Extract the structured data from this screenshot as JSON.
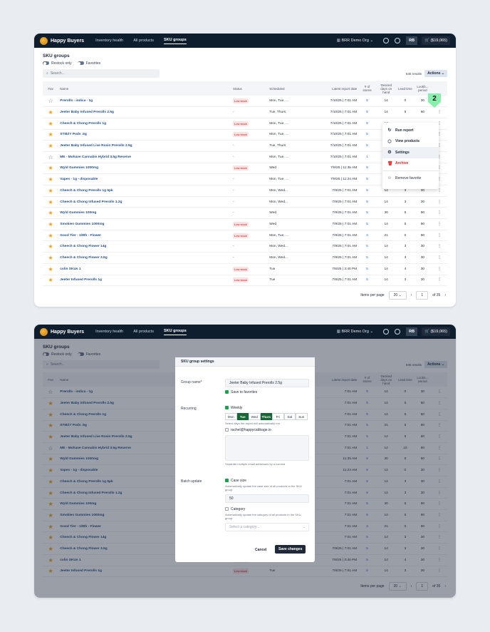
{
  "nav": {
    "brand": "Happy Buyers",
    "items": [
      "Inventory health",
      "All products",
      "SKU groups"
    ],
    "active": "SKU groups",
    "org": "BRR Demo Org",
    "user": "RB",
    "cart": "($19,065)"
  },
  "page": {
    "title": "SKU groups",
    "toggle_restock": "Restock only",
    "toggle_favorites": "Favorites",
    "search_placeholder": "Search...",
    "results": "645 results",
    "actions": "Actions"
  },
  "columns": [
    "Fav",
    "Name",
    "Status",
    "Scheduled",
    "Latest report date",
    "# of stores",
    "Desired days on hand",
    "Lead time",
    "Lookb... period"
  ],
  "rows1": [
    {
      "fav": false,
      "name": "Prerolls - indica - 1g",
      "status": "Low stock",
      "sched": "Mon, Tue, ...",
      "date": "7/10/25 | 7:01 AM",
      "stores": "5",
      "ddoh": "14",
      "lead": "0",
      "look": "30"
    },
    {
      "fav": true,
      "name": "Jeeter Baby Infused Prerolls 2.5g",
      "status": "-",
      "sched": "Tue, Thurs",
      "date": "7/10/25 | 7:01 AM",
      "stores": "5",
      "ddoh": "14",
      "lead": "5",
      "look": "60"
    },
    {
      "fav": true,
      "name": "Cheech & Chong Prerolls 1g",
      "status": "Low stock",
      "sched": "Mon, Tue, ...",
      "date": "7/10/25 | 7:01 AM",
      "stores": "5",
      "ddoh": "14",
      "lead": "",
      "look": ""
    },
    {
      "fav": true,
      "name": "STIIIZY Pods .5g",
      "status": "Low stock",
      "sched": "Mon, Tue, ...",
      "date": "7/10/25 | 7:01 AM",
      "stores": "5",
      "ddoh": "21",
      "lead": "",
      "look": ""
    },
    {
      "fav": true,
      "name": "Jeeter Baby Infused Live Rosin Prerolls 2.5g",
      "status": "-",
      "sched": "Tue, Thurs",
      "date": "7/10/25 | 7:01 AM",
      "stores": "5",
      "ddoh": "14",
      "lead": "",
      "look": ""
    },
    {
      "fav": false,
      "name": "ME - Mohave Cannabis Hybrid 3.5g Reserve",
      "status": "-",
      "sched": "Mon, Tue, ...",
      "date": "7/10/25 | 7:01 AM",
      "stores": "1",
      "ddoh": "14",
      "lead": "",
      "look": ""
    },
    {
      "fav": true,
      "name": "Wyld Gummies 1000mg",
      "status": "Low stock",
      "sched": "Wed",
      "date": "7/9/25 | 11:35 AM",
      "stores": "5",
      "ddoh": "30",
      "lead": "",
      "look": ""
    },
    {
      "fav": true,
      "name": "Vapes - 1g - disposable",
      "status": "-",
      "sched": "Mon, Tue, ...",
      "date": "7/9/25 | 11:24 AM",
      "stores": "5",
      "ddoh": "14",
      "lead": "",
      "look": ""
    },
    {
      "fav": true,
      "name": "Cheech & Chong Prerolls 1g 5pk",
      "status": "-",
      "sched": "Mon, Wed...",
      "date": "7/9/25 | 7:01 AM",
      "stores": "5",
      "ddoh": "14",
      "lead": "3",
      "look": "30"
    },
    {
      "fav": true,
      "name": "Cheech & Chong Infused Prerolls 1.2g",
      "status": "-",
      "sched": "Mon, Wed...",
      "date": "7/9/25 | 7:01 AM",
      "stores": "5",
      "ddoh": "14",
      "lead": "3",
      "look": "30"
    },
    {
      "fav": true,
      "name": "Wyld Gummies 100mg",
      "status": "-",
      "sched": "Wed",
      "date": "7/9/25 | 7:01 AM",
      "stores": "5",
      "ddoh": "30",
      "lead": "5",
      "look": "90"
    },
    {
      "fav": true,
      "name": "Smokies Gummies 1000mg",
      "status": "Low stock",
      "sched": "Wed",
      "date": "7/9/25 | 7:01 AM",
      "stores": "5",
      "ddoh": "14",
      "lead": "5",
      "look": "90"
    },
    {
      "fav": true,
      "name": "Good Tier - 1/8th - Flower",
      "status": "Low stock",
      "sched": "Mon, Tue, ...",
      "date": "7/9/25 | 7:01 AM",
      "stores": "3",
      "ddoh": "21",
      "lead": "0",
      "look": "90"
    },
    {
      "fav": true,
      "name": "Cheech & Chong Flower 14g",
      "status": "-",
      "sched": "Mon, Wed...",
      "date": "7/9/25 | 7:01 AM",
      "stores": "5",
      "ddoh": "14",
      "lead": "3",
      "look": "30"
    },
    {
      "fav": true,
      "name": "Cheech & Chong Flower 3.5g",
      "status": "-",
      "sched": "Mon, Wed...",
      "date": "7/9/25 | 7:01 AM",
      "stores": "5",
      "ddoh": "14",
      "lead": "3",
      "look": "30"
    },
    {
      "fav": true,
      "name": "colin SKUs 1",
      "status": "Low stock",
      "sched": "Tue",
      "date": "7/8/25 | 3:40 PM",
      "stores": "5",
      "ddoh": "14",
      "lead": "4",
      "look": "30"
    },
    {
      "fav": true,
      "name": "Jeeter Infused Prerolls 1g",
      "status": "Low stock",
      "sched": "Tue",
      "date": "7/8/25 | 7:01 AM",
      "stores": "5",
      "ddoh": "14",
      "lead": "3",
      "look": "30"
    }
  ],
  "rows2": [
    {
      "fav": false,
      "name": "Prerolls - indica - 1g",
      "status": "",
      "date": "7:01 AM",
      "stores": "5",
      "ddoh": "14",
      "lead": "0",
      "look": "30"
    },
    {
      "fav": true,
      "name": "Jeeter Baby Infused Prerolls 2.5g",
      "status": "",
      "date": "7:01 AM",
      "stores": "5",
      "ddoh": "14",
      "lead": "5",
      "look": "60"
    },
    {
      "fav": true,
      "name": "Cheech & Chong Prerolls 1g",
      "status": "",
      "date": "7:01 AM",
      "stores": "5",
      "ddoh": "14",
      "lead": "5",
      "look": "60"
    },
    {
      "fav": true,
      "name": "STIIIZY Pods .5g",
      "status": "",
      "date": "7:01 AM",
      "stores": "5",
      "ddoh": "21",
      "lead": "5",
      "look": "90"
    },
    {
      "fav": true,
      "name": "Jeeter Baby Infused Live Rosin Prerolls 2.5g",
      "status": "",
      "date": "7:01 AM",
      "stores": "5",
      "ddoh": "14",
      "lead": "5",
      "look": "60"
    },
    {
      "fav": false,
      "name": "ME - Mohave Cannabis Hybrid 3.5g Reserve",
      "status": "",
      "date": "7:01 AM",
      "stores": "1",
      "ddoh": "14",
      "lead": "10",
      "look": "90"
    },
    {
      "fav": true,
      "name": "Wyld Gummies 1000mg",
      "status": "",
      "date": "11:35 AM",
      "stores": "5",
      "ddoh": "30",
      "lead": "5",
      "look": "90"
    },
    {
      "fav": true,
      "name": "Vapes - 1g - disposable",
      "status": "",
      "date": "11:24 AM",
      "stores": "5",
      "ddoh": "14",
      "lead": "0",
      "look": "30"
    },
    {
      "fav": true,
      "name": "Cheech & Chong Prerolls 1g 5pk",
      "status": "",
      "date": "7:01 AM",
      "stores": "5",
      "ddoh": "14",
      "lead": "3",
      "look": "30"
    },
    {
      "fav": true,
      "name": "Cheech & Chong Infused Prerolls 1.2g",
      "status": "",
      "date": "7:01 AM",
      "stores": "5",
      "ddoh": "14",
      "lead": "3",
      "look": "30"
    },
    {
      "fav": true,
      "name": "Wyld Gummies 100mg",
      "status": "",
      "date": "7:01 AM",
      "stores": "5",
      "ddoh": "30",
      "lead": "5",
      "look": "90"
    },
    {
      "fav": true,
      "name": "Smokies Gummies 1000mg",
      "status": "",
      "date": "7:01 AM",
      "stores": "5",
      "ddoh": "14",
      "lead": "5",
      "look": "90"
    },
    {
      "fav": true,
      "name": "Good Tier - 1/8th - Flower",
      "status": "",
      "date": "7:01 AM",
      "stores": "3",
      "ddoh": "21",
      "lead": "0",
      "look": "90"
    },
    {
      "fav": true,
      "name": "Cheech & Chong Flower 14g",
      "status": "",
      "date": "7:01 AM",
      "stores": "5",
      "ddoh": "14",
      "lead": "3",
      "look": "30"
    },
    {
      "fav": true,
      "name": "Cheech & Chong Flower 3.5g",
      "status": "-",
      "sched": "Mon, Wed...",
      "date": "7/9/25 | 7:01 AM",
      "stores": "5",
      "ddoh": "14",
      "lead": "3",
      "look": "30"
    },
    {
      "fav": true,
      "name": "colin SKUs 1",
      "status": "Low stock",
      "sched": "Tue",
      "date": "7/8/25 | 3:40 PM",
      "stores": "5",
      "ddoh": "14",
      "lead": "4",
      "look": "30"
    },
    {
      "fav": true,
      "name": "Jeeter Infused Prerolls 1g",
      "status": "Low stock",
      "sched": "Tue",
      "date": "7/8/25 | 7:01 AM",
      "stores": "5",
      "ddoh": "14",
      "lead": "3",
      "look": "30"
    }
  ],
  "pager": {
    "items_label": "Items per page",
    "per_page": "20",
    "page": "1",
    "of": "of 35"
  },
  "menu": {
    "run": "Run report",
    "view": "View products",
    "settings": "Settings",
    "archive": "Archive",
    "remove": "Remove favorite"
  },
  "callout": "2",
  "modal": {
    "title": "SKU group settings",
    "group_name_label": "Group name*",
    "group_name_value": "Jeeter Baby Infused Prerolls 2.5g",
    "save_fav": "Save to favorites",
    "recurring_label": "Recurring",
    "weekly": "Weekly",
    "days": [
      "Mon",
      "Tue",
      "Wed",
      "Thurs",
      "Fri",
      "Sat",
      "Sun"
    ],
    "days_on": [
      "Tue",
      "Thurs"
    ],
    "days_help": "Select days the report will automatically run",
    "email": "rachel@happycabbage.io",
    "email_help": "Separate multiple email addresses by a comma",
    "batch_label": "Batch update",
    "case_size": "Case size",
    "case_help": "Automatically update the case size of all products in the SKU group.",
    "case_value": "50",
    "category": "Category",
    "category_help": "Automatically update the category of all products in the SKU group.",
    "category_placeholder": "Select a category...",
    "cancel": "Cancel",
    "save": "Save changes"
  },
  "colors": {
    "navbar": "#0f1e2e",
    "accent_green": "#166534",
    "link": "#1e4e8c",
    "callout": "#86efac"
  }
}
